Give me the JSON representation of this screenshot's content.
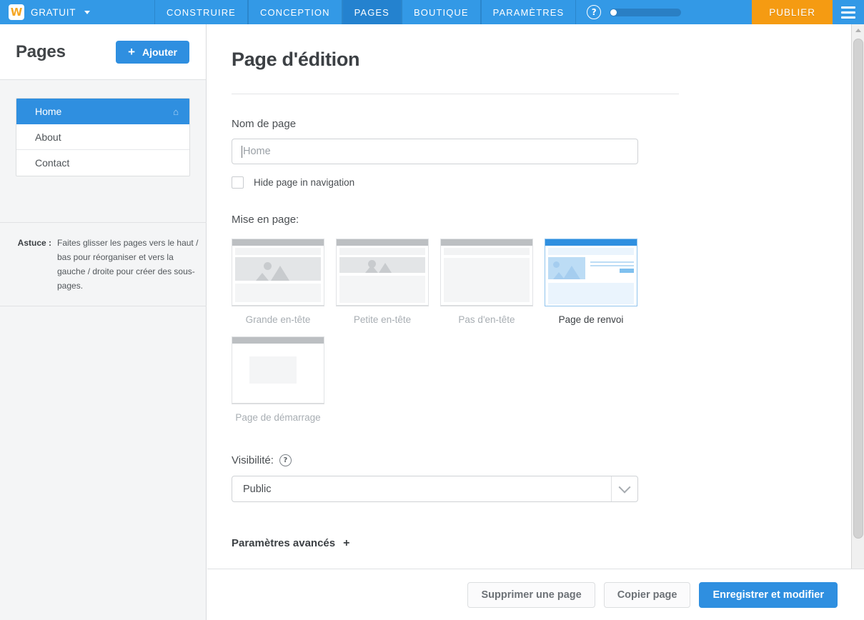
{
  "topbar": {
    "logo_letter": "W",
    "brand_label": "GRATUIT",
    "tabs": [
      {
        "label": "CONSTRUIRE",
        "active": false
      },
      {
        "label": "CONCEPTION",
        "active": false
      },
      {
        "label": "PAGES",
        "active": true
      },
      {
        "label": "BOUTIQUE",
        "active": false
      },
      {
        "label": "PARAMÈTRES",
        "active": false
      }
    ],
    "help_glyph": "?",
    "publish_label": "PUBLIER",
    "accent_blue": "#3399e6",
    "accent_orange": "#f59b12"
  },
  "sidebar": {
    "title": "Pages",
    "add_label": "Ajouter",
    "add_plus": "+",
    "items": [
      {
        "label": "Home",
        "selected": true,
        "icon": "home-icon"
      },
      {
        "label": "About",
        "selected": false
      },
      {
        "label": "Contact",
        "selected": false
      }
    ],
    "tip_label": "Astuce :",
    "tip_text": "Faites glisser les pages vers le haut / bas pour réorganiser et vers la gauche / droite pour créer des sous-pages."
  },
  "main": {
    "title": "Page d'édition",
    "page_name_label": "Nom de page",
    "page_name_value": "Home",
    "hide_checkbox_label": "Hide page in navigation",
    "layout_label": "Mise en page:",
    "layouts": [
      {
        "caption": "Grande en-tête",
        "selected": false
      },
      {
        "caption": "Petite en-tête",
        "selected": false
      },
      {
        "caption": "Pas d'en-tête",
        "selected": false
      },
      {
        "caption": "Page de renvoi",
        "selected": true
      },
      {
        "caption": "Page de démarrage",
        "selected": false
      }
    ],
    "visibility_label": "Visibilité:",
    "visibility_help_glyph": "?",
    "visibility_value": "Public",
    "advanced_label": "Paramètres avancés",
    "advanced_plus": "+"
  },
  "footer": {
    "delete_label": "Supprimer une page",
    "copy_label": "Copier page",
    "save_label": "Enregistrer et modifier"
  }
}
